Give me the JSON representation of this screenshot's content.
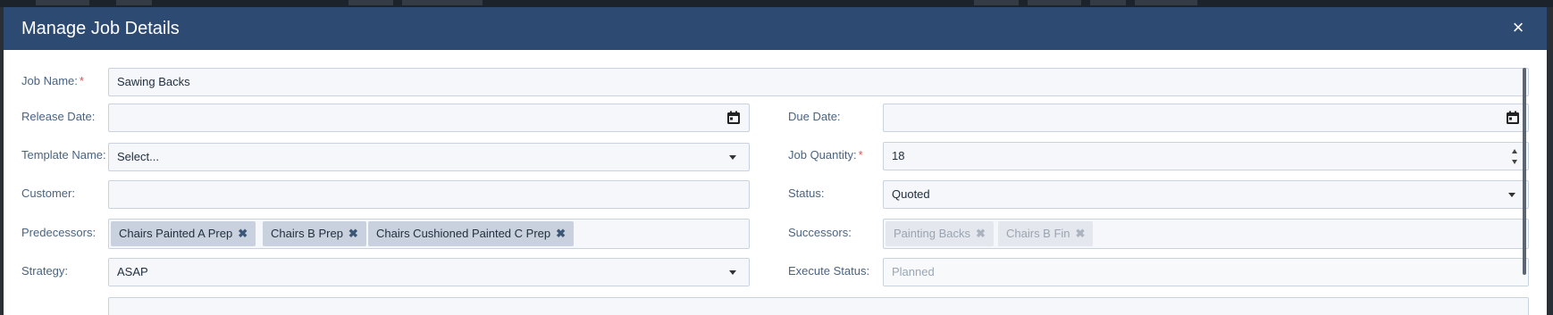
{
  "dialog": {
    "title": "Manage Job Details",
    "close_symbol": "×"
  },
  "form": {
    "job_name": {
      "label": "Job Name:",
      "required": "*",
      "value": "Sawing Backs"
    },
    "release_date": {
      "label": "Release Date:",
      "value": ""
    },
    "due_date": {
      "label": "Due Date:",
      "value": ""
    },
    "template_name": {
      "label": "Template Name:",
      "value": "Select..."
    },
    "job_quantity": {
      "label": "Job Quantity:",
      "required": "*",
      "value": "18"
    },
    "customer": {
      "label": "Customer:",
      "value": ""
    },
    "status": {
      "label": "Status:",
      "value": "Quoted"
    },
    "predecessors": {
      "label": "Predecessors:",
      "items": [
        "Chairs Painted A Prep",
        "Chairs B Prep",
        "Chairs Cushioned Painted C Prep"
      ]
    },
    "successors": {
      "label": "Successors:",
      "items": [
        "Painting Backs",
        "Chairs B Fin"
      ]
    },
    "strategy": {
      "label": "Strategy:",
      "value": "ASAP"
    },
    "execute_status": {
      "label": "Execute Status:",
      "value": "Planned"
    }
  },
  "remove_symbol": "✖",
  "colors": {
    "header_bg": "#2d4a72",
    "label": "#4a6380",
    "required": "#d9534f",
    "tag_bg": "#c8d1dd",
    "tag_disabled_bg": "#e4e8ee"
  }
}
